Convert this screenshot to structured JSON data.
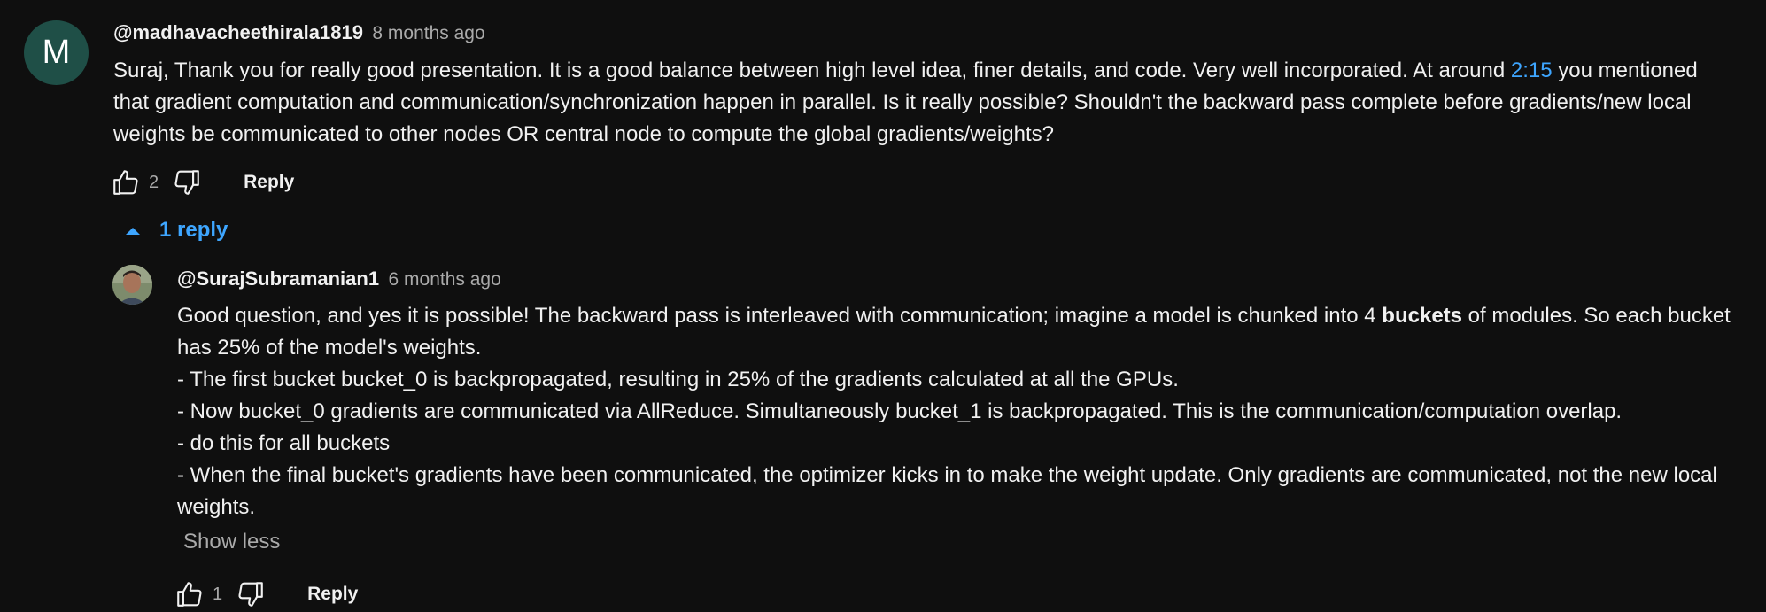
{
  "comment": {
    "avatar_letter": "M",
    "author": "@madhavacheethirala1819",
    "time": "8 months ago",
    "text_before_link": "Suraj, Thank you for really good presentation. It is a good balance between high level idea, finer details, and code. Very well incorporated. At around ",
    "timestamp_link": "2:15",
    "text_after_link": " you mentioned that gradient computation and communication/synchronization happen in parallel. Is it really possible? Shouldn't the backward pass complete before gradients/new local weights be communicated to other nodes OR central node to compute the global gradients/weights?",
    "like_count": "2",
    "reply_label": "Reply",
    "like_icon": "thumbs-up-icon",
    "dislike_icon": "thumbs-down-icon"
  },
  "replies_toggle": {
    "label": "1 reply",
    "icon": "caret-up-icon"
  },
  "reply": {
    "author": "@SurajSubramanian1",
    "time": "6 months ago",
    "line1_before_bold": "Good question, and yes it is possible! The backward pass is interleaved with communication; imagine a model is chunked into 4 ",
    "line1_bold": "buckets",
    "line1_after_bold": " of modules. So each bucket has 25% of the model's weights.",
    "bullet1": "- The first bucket bucket_0 is backpropagated, resulting in 25% of the gradients calculated at all the GPUs.",
    "bullet2": "- Now bucket_0 gradients are communicated via AllReduce. Simultaneously bucket_1 is backpropagated. This is the communication/computation overlap.",
    "bullet3": "- do this for all buckets",
    "bullet4": "- When the final bucket's gradients have been communicated, the optimizer kicks in to make the weight update. Only gradients are communicated, not the new local weights.",
    "show_less_label": "Show less",
    "like_count": "1",
    "reply_label": "Reply"
  },
  "colors": {
    "background": "#0f0f0f",
    "text": "#f1f1f1",
    "secondary_text": "#aaaaaa",
    "link": "#3ea6ff",
    "avatar_bg": "#1f4f47"
  }
}
